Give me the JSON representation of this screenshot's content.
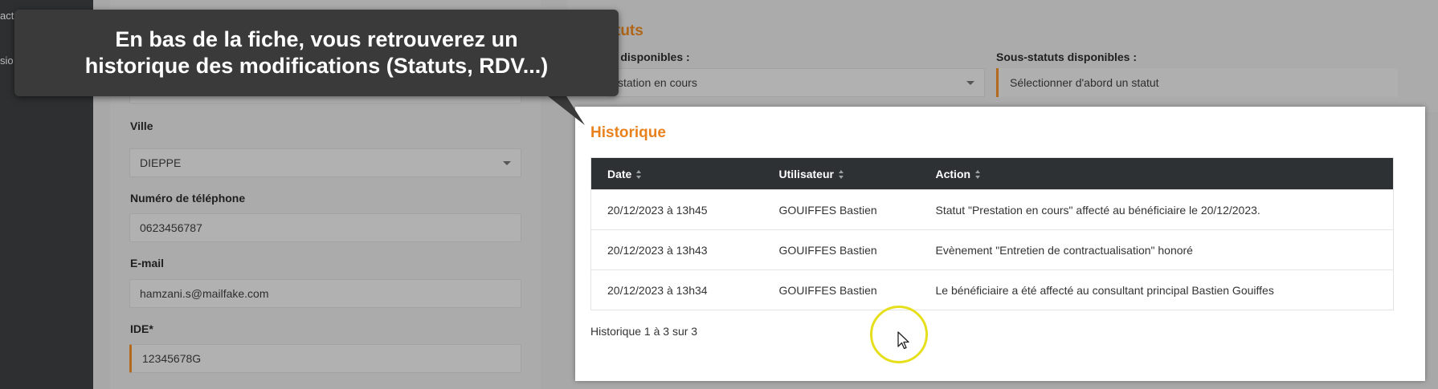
{
  "sidebar": {
    "items": [
      {
        "label": "act"
      },
      {
        "label": "sio"
      }
    ]
  },
  "form": {
    "ville_label": "Ville",
    "ville_value": "DIEPPE",
    "phone_label": "Numéro de téléphone",
    "phone_value": "0623456787",
    "email_label": "E-mail",
    "email_value": "hamzani.s@mailfake.com",
    "ide_label": "IDE*",
    "ide_value": "12345678G"
  },
  "status": {
    "title": "tuts",
    "available_label": "ts disponibles :",
    "selected_value": "station en cours",
    "sub_label": "Sous-statuts disponibles :",
    "sub_placeholder": "Sélectionner d'abord un statut"
  },
  "historique": {
    "title": "Historique",
    "columns": [
      {
        "label": "Date"
      },
      {
        "label": "Utilisateur"
      },
      {
        "label": "Action"
      }
    ],
    "rows": [
      {
        "date": "20/12/2023 à 13h45",
        "user": "GOUIFFES Bastien",
        "action": "Statut \"Prestation en cours\" affecté au bénéficiaire le 20/12/2023."
      },
      {
        "date": "20/12/2023 à 13h43",
        "user": "GOUIFFES Bastien",
        "action": "Evènement \"Entretien de contractualisation\" honoré"
      },
      {
        "date": "20/12/2023 à 13h34",
        "user": "GOUIFFES Bastien",
        "action": "Le bénéficiaire a été affecté au consultant principal Bastien Gouiffes"
      }
    ],
    "count_text": "Historique 1 à 3 sur 3"
  },
  "tooltip": {
    "line1": "En bas de la fiche, vous retrouverez un",
    "line2": "historique des modifications (Statuts, RDV...)"
  },
  "colors": {
    "accent_orange": "#e8821e",
    "table_header": "#2d3134",
    "highlight_ring": "#e6df1e"
  }
}
